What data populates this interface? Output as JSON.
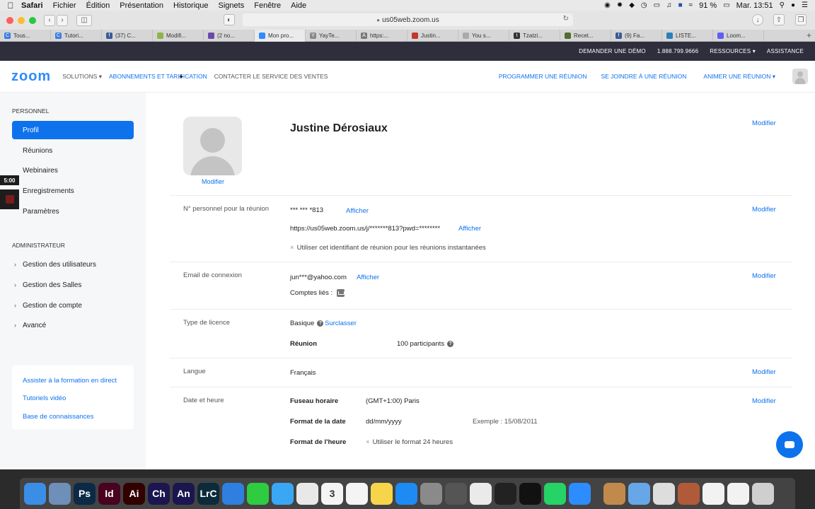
{
  "menubar": {
    "items": [
      "Safari",
      "Fichier",
      "Édition",
      "Présentation",
      "Historique",
      "Signets",
      "Fenêtre",
      "Aide"
    ],
    "battery": "91 %",
    "clock": "Mar. 13:51"
  },
  "browser": {
    "url": "us05web.zoom.us",
    "tabs": [
      {
        "label": "Tous...",
        "fav": "C",
        "color": "#3b7ce0"
      },
      {
        "label": "Tutori...",
        "fav": "C",
        "color": "#3b7ce0"
      },
      {
        "label": "(37) C...",
        "fav": "f",
        "color": "#3b5998"
      },
      {
        "label": "Modifi...",
        "fav": "",
        "color": "#8fb34b"
      },
      {
        "label": "(2 no...",
        "fav": "",
        "color": "#6b4aa6"
      },
      {
        "label": "Mon pro...",
        "fav": "",
        "color": "#2d8cff"
      },
      {
        "label": "YayTe...",
        "fav": "Y",
        "color": "#888888"
      },
      {
        "label": "https:...",
        "fav": "A",
        "color": "#777777"
      },
      {
        "label": "Justin...",
        "fav": "",
        "color": "#c0392b"
      },
      {
        "label": "You s...",
        "fav": "",
        "color": "#aaaaaa"
      },
      {
        "label": "Tzatzi...",
        "fav": "t",
        "color": "#333333"
      },
      {
        "label": "Recet...",
        "fav": "",
        "color": "#556b2f"
      },
      {
        "label": "(9) Fa...",
        "fav": "f",
        "color": "#3b5998"
      },
      {
        "label": "LISTE...",
        "fav": "",
        "color": "#2980b9"
      },
      {
        "label": "Loom...",
        "fav": "",
        "color": "#625df5"
      }
    ]
  },
  "topbar": {
    "demo": "DEMANDER UNE DÉMO",
    "phone": "1.888.799.9666",
    "resources": "RESSOURCES",
    "assistance": "ASSISTANCE"
  },
  "nav": {
    "logo": "zoom",
    "solutions": "SOLUTIONS",
    "plans": "ABONNEMENTS ET TARIFICATION",
    "sales": "CONTACTER LE SERVICE DES VENTES",
    "schedule": "PROGRAMMER UNE RÉUNION",
    "join": "SE JOINDRE À UNE RÉUNION",
    "host": "ANIMER UNE RÉUNION"
  },
  "sidebar": {
    "personal_title": "PERSONNEL",
    "personal_items": [
      "Profil",
      "Réunions",
      "Webinaires",
      "Enregistrements",
      "Paramètres"
    ],
    "admin_title": "ADMINISTRATEUR",
    "admin_items": [
      "Gestion des utilisateurs",
      "Gestion des Salles",
      "Gestion de compte",
      "Avancé"
    ],
    "links": [
      "Assister à la formation en direct",
      "Tutoriels vidéo",
      "Base de connaissances"
    ],
    "timer": "5:00"
  },
  "profile": {
    "photo_modify": "Modifier",
    "name": "Justine Dérosiaux",
    "modify": "Modifier",
    "pmi_label": "N° personnel pour la réunion",
    "pmi_value": "*** *** *813",
    "show": "Afficher",
    "pmi_url": "https://us05web.zoom.us/j/*******813?pwd=********",
    "pmi_instant": "Utiliser cet identifiant de réunion pour les réunions instantanées",
    "email_label": "Email de connexion",
    "email_value": "jun***@yahoo.com",
    "linked_accounts": "Comptes liés :",
    "license_label": "Type de licence",
    "license_value": "Basique",
    "upgrade": "Surclasser",
    "meeting_label": "Réunion",
    "meeting_value": "100 participants",
    "language_label": "Langue",
    "language_value": "Français",
    "datetime_label": "Date et heure",
    "timezone_label": "Fuseau horaire",
    "timezone_value": "(GMT+1:00) Paris",
    "dateformat_label": "Format de la date",
    "dateformat_value": "dd/mm/yyyy",
    "dateformat_example": "Exemple : 15/08/2011",
    "timeformat_label": "Format de l'heure",
    "timeformat_value": "Utiliser le format 24 heures"
  },
  "dock": {
    "apps": [
      {
        "name": "finder",
        "label": "",
        "color": "#3a8ee6"
      },
      {
        "name": "preview",
        "label": "",
        "color": "#6d8fb8"
      },
      {
        "name": "photoshop",
        "label": "Ps",
        "color": "#0b2a46"
      },
      {
        "name": "indesign",
        "label": "Id",
        "color": "#49021f"
      },
      {
        "name": "illustrator",
        "label": "Ai",
        "color": "#330000"
      },
      {
        "name": "character-animator",
        "label": "Ch",
        "color": "#1b1650"
      },
      {
        "name": "animate",
        "label": "An",
        "color": "#1b1650"
      },
      {
        "name": "lightroom-classic",
        "label": "LrC",
        "color": "#0b2a3a"
      },
      {
        "name": "safari",
        "label": "",
        "color": "#2f7fe0"
      },
      {
        "name": "facetime",
        "label": "",
        "color": "#2ecc40"
      },
      {
        "name": "messages",
        "label": "",
        "color": "#3aa7f5"
      },
      {
        "name": "photos",
        "label": "",
        "color": "#e8e8e8"
      },
      {
        "name": "calendar",
        "label": "3",
        "color": "#f4f4f4"
      },
      {
        "name": "reminders",
        "label": "",
        "color": "#f4f4f4"
      },
      {
        "name": "notes",
        "label": "",
        "color": "#f7d54a"
      },
      {
        "name": "app-store",
        "label": "",
        "color": "#1d8bf3"
      },
      {
        "name": "system-preferences",
        "label": "",
        "color": "#8a8a8a"
      },
      {
        "name": "keynote",
        "label": "",
        "color": "#555555"
      },
      {
        "name": "textedit",
        "label": "",
        "color": "#eaeaea"
      },
      {
        "name": "activity-monitor",
        "label": "",
        "color": "#222222"
      },
      {
        "name": "kindle",
        "label": "",
        "color": "#111111"
      },
      {
        "name": "whatsapp",
        "label": "",
        "color": "#25d366"
      },
      {
        "name": "zoom",
        "label": "",
        "color": "#2d8cff"
      },
      {
        "name": "home-folder",
        "label": "",
        "color": "#c28a4a"
      },
      {
        "name": "applications-folder",
        "label": "",
        "color": "#67a7e8"
      },
      {
        "name": "printer",
        "label": "",
        "color": "#dddddd"
      },
      {
        "name": "downloads",
        "label": "",
        "color": "#b05a3a"
      },
      {
        "name": "document",
        "label": "",
        "color": "#f2f2f2"
      },
      {
        "name": "document-2",
        "label": "",
        "color": "#f2f2f2"
      },
      {
        "name": "trash",
        "label": "",
        "color": "#cfcfcf"
      }
    ]
  }
}
